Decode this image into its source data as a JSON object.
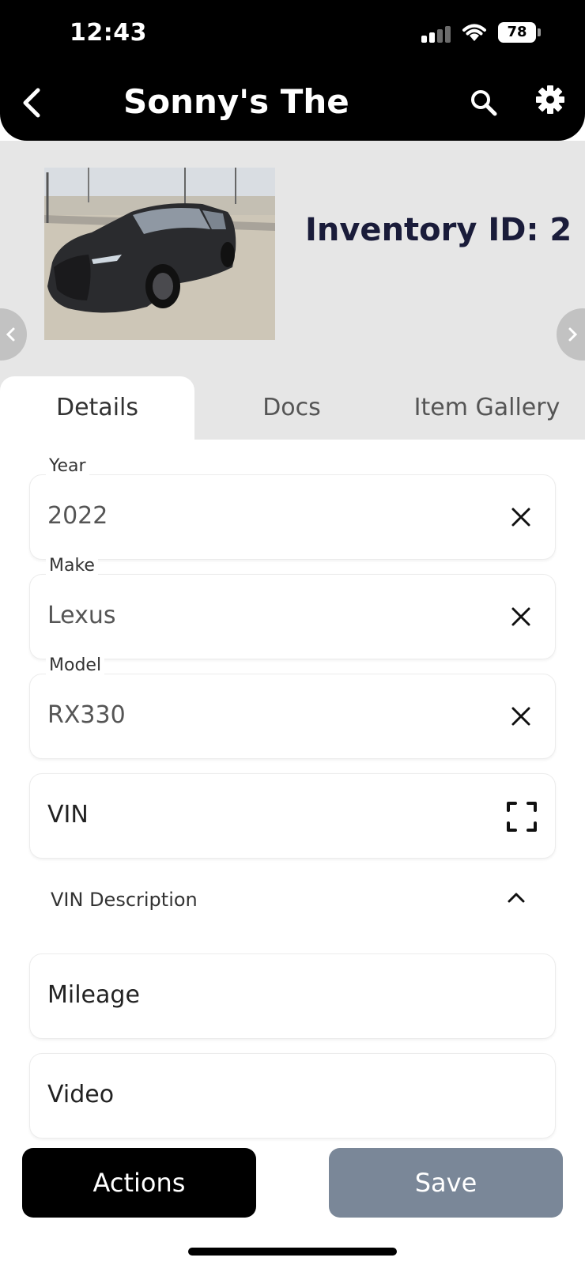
{
  "status_bar": {
    "time": "12:43",
    "battery": "78"
  },
  "header": {
    "title": "Sonny's The ..."
  },
  "hero": {
    "inventory_label": "Inventory ID: 2"
  },
  "tabs": [
    {
      "label": "Details",
      "active": true
    },
    {
      "label": "Docs",
      "active": false
    },
    {
      "label": "Item Gallery",
      "active": false
    }
  ],
  "fields": {
    "year": {
      "label": "Year",
      "value": "2022"
    },
    "make": {
      "label": "Make",
      "value": "Lexus"
    },
    "model": {
      "label": "Model",
      "value": "RX330"
    },
    "vin": {
      "placeholder": "VIN"
    },
    "vin_description": {
      "label": "VIN Description"
    },
    "mileage": {
      "placeholder": "Mileage"
    },
    "video": {
      "placeholder": "Video"
    }
  },
  "buttons": {
    "actions": "Actions",
    "save": "Save"
  },
  "colors": {
    "header_bg": "#000000",
    "hero_bg": "#e6e6e6",
    "inventory_text": "#1a1c3a",
    "save_button": "#7a8798",
    "actions_button": "#000000"
  },
  "icons": [
    "back-icon",
    "search-icon",
    "gear-icon",
    "chevron-left-icon",
    "chevron-right-icon",
    "close-icon",
    "scan-icon",
    "chevron-up-icon"
  ]
}
